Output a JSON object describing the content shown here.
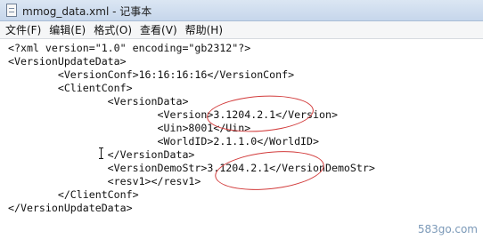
{
  "window": {
    "title": "mmog_data.xml - 记事本",
    "icon": "notepad-icon"
  },
  "menubar": {
    "items": [
      "文件(F)",
      "编辑(E)",
      "格式(O)",
      "查看(V)",
      "帮助(H)"
    ]
  },
  "editor": {
    "lines": [
      "<?xml version=\"1.0\" encoding=\"gb2312\"?>",
      "<VersionUpdateData>",
      "        <VersionConf>16:16:16:16</VersionConf>",
      "        <ClientConf>",
      "                <VersionData>",
      "                        <Version>3.1204.2.1</Version>",
      "                        <Uin>8001</Uin>",
      "                        <WorldID>2.1.1.0</WorldID>",
      "                </VersionData>",
      "                <VersionDemoStr>3.1204.2.1</VersionDemoStr>",
      "                <resv1></resv1>",
      "        </ClientConf>",
      "</VersionUpdateData>"
    ]
  },
  "annotation": {
    "color": "#d23b3b"
  },
  "watermark": "583go.com"
}
